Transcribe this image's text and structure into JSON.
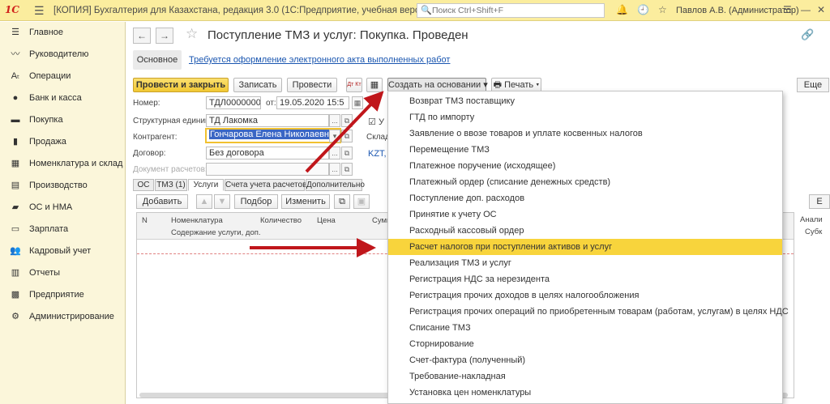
{
  "app": {
    "logo": "1С",
    "title": "[КОПИЯ] Бухгалтерия для Казахстана, редакция 3.0  (1С:Предприятие, учебная версия)",
    "search_placeholder": "Поиск Ctrl+Shift+F",
    "user": "Павлов А.В. (Администратор)"
  },
  "sidebar": {
    "items": [
      {
        "label": "Главное",
        "icon": "menu-icon"
      },
      {
        "label": "Руководителю",
        "icon": "chart-icon"
      },
      {
        "label": "Операции",
        "icon": "operations-icon"
      },
      {
        "label": "Банк и касса",
        "icon": "bank-icon"
      },
      {
        "label": "Покупка",
        "icon": "cart-icon"
      },
      {
        "label": "Продажа",
        "icon": "bag-icon"
      },
      {
        "label": "Номенклатура и склад",
        "icon": "warehouse-icon"
      },
      {
        "label": "Производство",
        "icon": "factory-icon"
      },
      {
        "label": "ОС и НМА",
        "icon": "truck-icon"
      },
      {
        "label": "Зарплата",
        "icon": "salary-icon"
      },
      {
        "label": "Кадровый учет",
        "icon": "people-icon"
      },
      {
        "label": "Отчеты",
        "icon": "reports-icon"
      },
      {
        "label": "Предприятие",
        "icon": "enterprise-icon"
      },
      {
        "label": "Администрирование",
        "icon": "gear-icon"
      }
    ]
  },
  "document": {
    "title": "Поступление ТМЗ и услуг: Покупка. Проведен",
    "tab_main": "Основное",
    "notice": "Требуется оформление электронного акта выполненных работ"
  },
  "toolbar": {
    "post_close": "Провести и закрыть",
    "save": "Записать",
    "post": "Провести",
    "dt_kt": "Дт Кт",
    "create_based": "Создать на основании",
    "print": "Печать",
    "more": "Еще"
  },
  "form": {
    "number_label": "Номер:",
    "number_value": "ТДЛ00000006",
    "from_label": "от:",
    "date_value": "19.05.2020 15:5",
    "unit_label": "Структурная единица:",
    "unit_value": "ТД Лакомка",
    "counterparty_label": "Контрагент:",
    "counterparty_value": "Гончарова Елена Николаевна",
    "contract_label": "Договор:",
    "contract_value": "Без договора",
    "settlement_label": "Документ расчетов:",
    "warehouse_label": "Склад",
    "currency": "KZT,",
    "check_label": "У"
  },
  "subtabs": [
    "ОС",
    "ТМЗ (1)",
    "Услуги",
    "Счета учета расчетов",
    "Дополнительно"
  ],
  "table_toolbar": {
    "add": "Добавить",
    "select": "Подбор",
    "change": "Изменить",
    "right_btn": "Е"
  },
  "table": {
    "columns": [
      "N",
      "Номенклатура",
      "Количество",
      "Цена",
      "Сумм"
    ],
    "sub_column": "Содержание услуги, доп.",
    "right_cols": [
      "Анали",
      "Субк"
    ]
  },
  "dropdown": {
    "items": [
      "Возврат ТМЗ поставщику",
      "ГТД по импорту",
      "Заявление о ввозе товаров и уплате косвенных налогов",
      "Перемещение ТМЗ",
      "Платежное поручение (исходящее)",
      "Платежный ордер (списание денежных средств)",
      "Поступление доп. расходов",
      "Принятие к учету ОС",
      "Расходный кассовый ордер",
      "Расчет налогов при поступлении активов и услуг",
      "Реализация ТМЗ и услуг",
      "Регистрация НДС за нерезидента",
      "Регистрация прочих доходов в целях налогообложения",
      "Регистрация прочих операций по приобретенным товарам (работам, услугам) в целях НДС",
      "Списание ТМЗ",
      "Сторнирование",
      "Счет-фактура (полученный)",
      "Требование-накладная",
      "Установка цен номенклатуры"
    ],
    "highlighted": "Расчет налогов при поступлении активов и услуг"
  },
  "colors": {
    "top_bar": "#fbed9e",
    "sidebar": "#fbf6da",
    "highlight": "#f8d43c",
    "arrow": "#c0161b",
    "link": "#1a56b0"
  }
}
